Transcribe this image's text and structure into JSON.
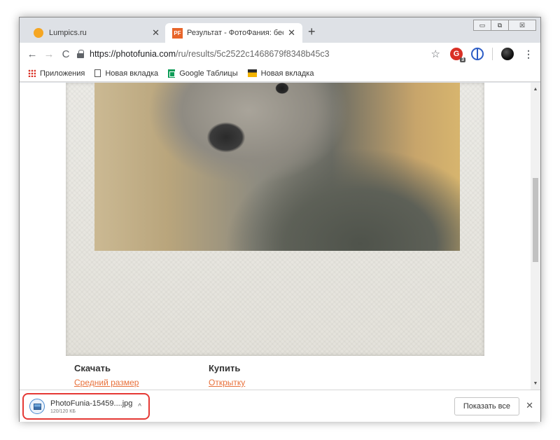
{
  "tabs": [
    {
      "title": "Lumpics.ru",
      "active": false
    },
    {
      "title": "Результат - ФотоФания: беспла",
      "favicon_text": "PF",
      "active": true
    }
  ],
  "window_controls": {
    "minimize": "▭",
    "maximize": "⧉",
    "close": "☒"
  },
  "toolbar": {
    "back_icon": "←",
    "forward_icon": "→",
    "reload_icon": "C",
    "url_domain": "https://photofunia.com",
    "url_path": "/ru/results/5c2522c1468679f8348b45c3",
    "star_icon": "☆",
    "ext_badge": "3",
    "menu_icon": "⋮"
  },
  "bookmarks": [
    {
      "label": "Приложения"
    },
    {
      "label": "Новая вкладка"
    },
    {
      "label": "Google Таблицы"
    },
    {
      "label": "Новая вкладка"
    }
  ],
  "actions": {
    "download_title": "Скачать",
    "download_link": "Средний размер",
    "buy_title": "Купить",
    "buy_link": "Открытку"
  },
  "download_bar": {
    "filename": "PhotoFunia-15459....jpg",
    "size": "120/120 КБ",
    "chevron": "^",
    "show_all": "Показать все",
    "close": "✕"
  },
  "colors": {
    "accent_link": "#e8703a",
    "highlight": "#e53935"
  }
}
